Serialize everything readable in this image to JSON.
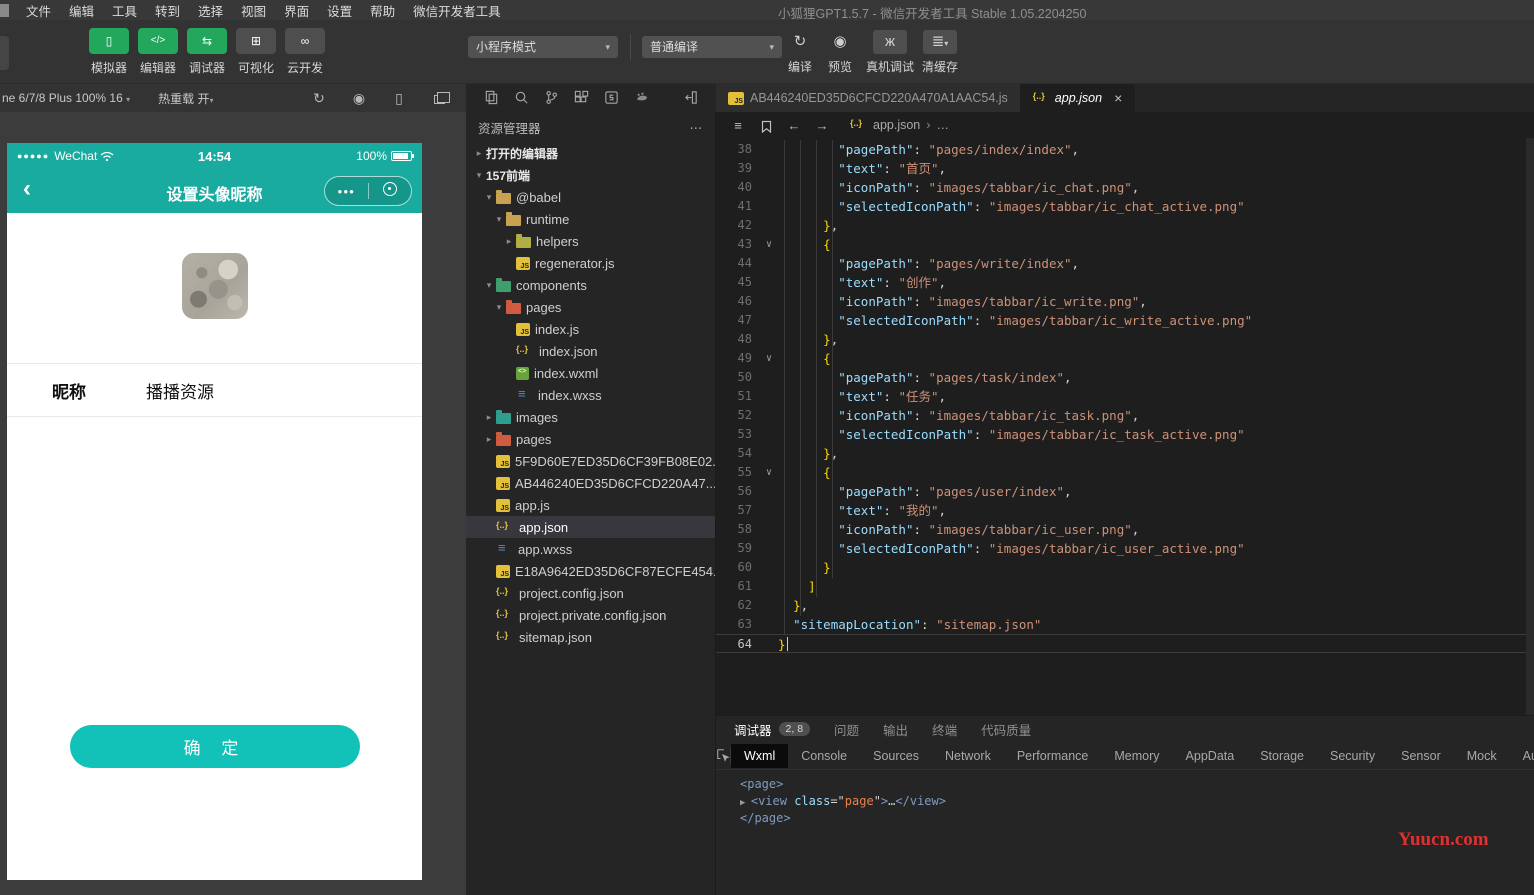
{
  "colors": {
    "wechat_green": "#22a75d",
    "phone_teal": "#19ab9f",
    "confirm_teal": "#12c1b7",
    "editor_key": "#9cdcfe",
    "editor_string": "#ce9178",
    "editor_brace": "#ffd700",
    "watermark_red": "#e03030",
    "selected_row": "#37373d"
  },
  "window": {
    "title": "小狐狸GPT1.5.7 - 微信开发者工具 Stable 1.05.2204250",
    "menu": [
      "文件",
      "编辑",
      "工具",
      "转到",
      "选择",
      "视图",
      "界面",
      "设置",
      "帮助",
      "微信开发者工具"
    ]
  },
  "toolbar": {
    "simulator": "模拟器",
    "editor": "编辑器",
    "debugger": "调试器",
    "visual": "可视化",
    "cloud": "云开发",
    "mode_select": "小程序模式",
    "compile_select": "普通编译",
    "compile": "编译",
    "preview": "预览",
    "real_device": "真机调试",
    "clear_cache": "清缓存"
  },
  "simbar": {
    "device": "ne 6/7/8 Plus 100% 16",
    "hot_reload": "热重载 开"
  },
  "phone": {
    "carrier": "WeChat",
    "signal_dots": "●●●●●",
    "time": "14:54",
    "battery": "100%",
    "back": "‹",
    "nav_title": "设置头像昵称",
    "capsule_more": "●●●",
    "nick_label": "昵称",
    "nick_value": "播播资源",
    "confirm": "确 定"
  },
  "explorer": {
    "title": "资源管理器",
    "more": "⋯",
    "items": [
      {
        "label": "打开的编辑器",
        "depth": 0,
        "arrow": "▸",
        "icon": "none",
        "section": true
      },
      {
        "label": "157前端",
        "depth": 0,
        "arrow": "▾",
        "icon": "none",
        "section": true
      },
      {
        "label": "@babel",
        "depth": 1,
        "arrow": "▾",
        "icon": "folder-yellow"
      },
      {
        "label": "runtime",
        "depth": 2,
        "arrow": "▾",
        "icon": "folder-yellow"
      },
      {
        "label": "helpers",
        "depth": 3,
        "arrow": "▸",
        "icon": "folder-olive"
      },
      {
        "label": "regenerator.js",
        "depth": 3,
        "arrow": "",
        "icon": "js"
      },
      {
        "label": "components",
        "depth": 1,
        "arrow": "▾",
        "icon": "folder-green"
      },
      {
        "label": "pages",
        "depth": 2,
        "arrow": "▾",
        "icon": "folder-red"
      },
      {
        "label": "index.js",
        "depth": 3,
        "arrow": "",
        "icon": "js"
      },
      {
        "label": "index.json",
        "depth": 3,
        "arrow": "",
        "icon": "json"
      },
      {
        "label": "index.wxml",
        "depth": 3,
        "arrow": "",
        "icon": "wxml"
      },
      {
        "label": "index.wxss",
        "depth": 3,
        "arrow": "",
        "icon": "wxss"
      },
      {
        "label": "images",
        "depth": 1,
        "arrow": "▸",
        "icon": "folder-teal"
      },
      {
        "label": "pages",
        "depth": 1,
        "arrow": "▸",
        "icon": "folder-red"
      },
      {
        "label": "5F9D60E7ED35D6CF39FB08E02...",
        "depth": 1,
        "arrow": "",
        "icon": "js"
      },
      {
        "label": "AB446240ED35D6CFCD220A47...",
        "depth": 1,
        "arrow": "",
        "icon": "js"
      },
      {
        "label": "app.js",
        "depth": 1,
        "arrow": "",
        "icon": "js"
      },
      {
        "label": "app.json",
        "depth": 1,
        "arrow": "",
        "icon": "json",
        "selected": true
      },
      {
        "label": "app.wxss",
        "depth": 1,
        "arrow": "",
        "icon": "wxss"
      },
      {
        "label": "E18A9642ED35D6CF87ECFE454...",
        "depth": 1,
        "arrow": "",
        "icon": "js"
      },
      {
        "label": "project.config.json",
        "depth": 1,
        "arrow": "",
        "icon": "json"
      },
      {
        "label": "project.private.config.json",
        "depth": 1,
        "arrow": "",
        "icon": "json"
      },
      {
        "label": "sitemap.json",
        "depth": 1,
        "arrow": "",
        "icon": "json"
      }
    ]
  },
  "editor": {
    "tab1": "AB446240ED35D6CFCD220A470A1AAC54.js",
    "tab2": "app.json",
    "tab2_close": "×",
    "breadcrumb_file": "app.json",
    "breadcrumb_more": "…",
    "code_lines": [
      {
        "n": 38,
        "fold": "",
        "tokens": [
          [
            "ws",
            "        "
          ],
          [
            "key",
            "\"pagePath\""
          ],
          [
            "pun",
            ": "
          ],
          [
            "str",
            "\"pages/index/index\""
          ],
          [
            "pun",
            ","
          ]
        ]
      },
      {
        "n": 39,
        "fold": "",
        "tokens": [
          [
            "ws",
            "        "
          ],
          [
            "key",
            "\"text\""
          ],
          [
            "pun",
            ": "
          ],
          [
            "str",
            "\"首页\""
          ],
          [
            "pun",
            ","
          ]
        ]
      },
      {
        "n": 40,
        "fold": "",
        "tokens": [
          [
            "ws",
            "        "
          ],
          [
            "key",
            "\"iconPath\""
          ],
          [
            "pun",
            ": "
          ],
          [
            "str",
            "\"images/tabbar/ic_chat.png\""
          ],
          [
            "pun",
            ","
          ]
        ]
      },
      {
        "n": 41,
        "fold": "",
        "tokens": [
          [
            "ws",
            "        "
          ],
          [
            "key",
            "\"selectedIconPath\""
          ],
          [
            "pun",
            ": "
          ],
          [
            "str",
            "\"images/tabbar/ic_chat_active.png\""
          ]
        ]
      },
      {
        "n": 42,
        "fold": "",
        "tokens": [
          [
            "ws",
            "      "
          ],
          [
            "br",
            "}"
          ],
          [
            "pun",
            ","
          ]
        ]
      },
      {
        "n": 43,
        "fold": "∨",
        "tokens": [
          [
            "ws",
            "      "
          ],
          [
            "br",
            "{"
          ]
        ]
      },
      {
        "n": 44,
        "fold": "",
        "tokens": [
          [
            "ws",
            "        "
          ],
          [
            "key",
            "\"pagePath\""
          ],
          [
            "pun",
            ": "
          ],
          [
            "str",
            "\"pages/write/index\""
          ],
          [
            "pun",
            ","
          ]
        ]
      },
      {
        "n": 45,
        "fold": "",
        "tokens": [
          [
            "ws",
            "        "
          ],
          [
            "key",
            "\"text\""
          ],
          [
            "pun",
            ": "
          ],
          [
            "str",
            "\"创作\""
          ],
          [
            "pun",
            ","
          ]
        ]
      },
      {
        "n": 46,
        "fold": "",
        "tokens": [
          [
            "ws",
            "        "
          ],
          [
            "key",
            "\"iconPath\""
          ],
          [
            "pun",
            ": "
          ],
          [
            "str",
            "\"images/tabbar/ic_write.png\""
          ],
          [
            "pun",
            ","
          ]
        ]
      },
      {
        "n": 47,
        "fold": "",
        "tokens": [
          [
            "ws",
            "        "
          ],
          [
            "key",
            "\"selectedIconPath\""
          ],
          [
            "pun",
            ": "
          ],
          [
            "str",
            "\"images/tabbar/ic_write_active.png\""
          ]
        ]
      },
      {
        "n": 48,
        "fold": "",
        "tokens": [
          [
            "ws",
            "      "
          ],
          [
            "br",
            "}"
          ],
          [
            "pun",
            ","
          ]
        ]
      },
      {
        "n": 49,
        "fold": "∨",
        "tokens": [
          [
            "ws",
            "      "
          ],
          [
            "br",
            "{"
          ]
        ]
      },
      {
        "n": 50,
        "fold": "",
        "tokens": [
          [
            "ws",
            "        "
          ],
          [
            "key",
            "\"pagePath\""
          ],
          [
            "pun",
            ": "
          ],
          [
            "str",
            "\"pages/task/index\""
          ],
          [
            "pun",
            ","
          ]
        ]
      },
      {
        "n": 51,
        "fold": "",
        "tokens": [
          [
            "ws",
            "        "
          ],
          [
            "key",
            "\"text\""
          ],
          [
            "pun",
            ": "
          ],
          [
            "str",
            "\"任务\""
          ],
          [
            "pun",
            ","
          ]
        ]
      },
      {
        "n": 52,
        "fold": "",
        "tokens": [
          [
            "ws",
            "        "
          ],
          [
            "key",
            "\"iconPath\""
          ],
          [
            "pun",
            ": "
          ],
          [
            "str",
            "\"images/tabbar/ic_task.png\""
          ],
          [
            "pun",
            ","
          ]
        ]
      },
      {
        "n": 53,
        "fold": "",
        "tokens": [
          [
            "ws",
            "        "
          ],
          [
            "key",
            "\"selectedIconPath\""
          ],
          [
            "pun",
            ": "
          ],
          [
            "str",
            "\"images/tabbar/ic_task_active.png\""
          ]
        ]
      },
      {
        "n": 54,
        "fold": "",
        "tokens": [
          [
            "ws",
            "      "
          ],
          [
            "br",
            "}"
          ],
          [
            "pun",
            ","
          ]
        ]
      },
      {
        "n": 55,
        "fold": "∨",
        "tokens": [
          [
            "ws",
            "      "
          ],
          [
            "br",
            "{"
          ]
        ]
      },
      {
        "n": 56,
        "fold": "",
        "tokens": [
          [
            "ws",
            "        "
          ],
          [
            "key",
            "\"pagePath\""
          ],
          [
            "pun",
            ": "
          ],
          [
            "str",
            "\"pages/user/index\""
          ],
          [
            "pun",
            ","
          ]
        ]
      },
      {
        "n": 57,
        "fold": "",
        "tokens": [
          [
            "ws",
            "        "
          ],
          [
            "key",
            "\"text\""
          ],
          [
            "pun",
            ": "
          ],
          [
            "str",
            "\"我的\""
          ],
          [
            "pun",
            ","
          ]
        ]
      },
      {
        "n": 58,
        "fold": "",
        "tokens": [
          [
            "ws",
            "        "
          ],
          [
            "key",
            "\"iconPath\""
          ],
          [
            "pun",
            ": "
          ],
          [
            "str",
            "\"images/tabbar/ic_user.png\""
          ],
          [
            "pun",
            ","
          ]
        ]
      },
      {
        "n": 59,
        "fold": "",
        "tokens": [
          [
            "ws",
            "        "
          ],
          [
            "key",
            "\"selectedIconPath\""
          ],
          [
            "pun",
            ": "
          ],
          [
            "str",
            "\"images/tabbar/ic_user_active.png\""
          ]
        ]
      },
      {
        "n": 60,
        "fold": "",
        "tokens": [
          [
            "ws",
            "      "
          ],
          [
            "br",
            "}"
          ]
        ]
      },
      {
        "n": 61,
        "fold": "",
        "tokens": [
          [
            "ws",
            "    "
          ],
          [
            "br",
            "]"
          ]
        ]
      },
      {
        "n": 62,
        "fold": "",
        "tokens": [
          [
            "ws",
            "  "
          ],
          [
            "br",
            "}"
          ],
          [
            "pun",
            ","
          ]
        ]
      },
      {
        "n": 63,
        "fold": "",
        "tokens": [
          [
            "ws",
            "  "
          ],
          [
            "key",
            "\"sitemapLocation\""
          ],
          [
            "pun",
            ": "
          ],
          [
            "str",
            "\"sitemap.json\""
          ]
        ]
      },
      {
        "n": 64,
        "fold": "",
        "cursor": true,
        "tokens": [
          [
            "br",
            "}"
          ]
        ]
      }
    ]
  },
  "debug": {
    "panel_tabs": [
      {
        "label": "调试器",
        "active": true,
        "badge": "2, 8"
      },
      {
        "label": "问题"
      },
      {
        "label": "输出"
      },
      {
        "label": "终端"
      },
      {
        "label": "代码质量"
      }
    ],
    "devtools_tabs": [
      {
        "label": "Wxml",
        "active": true
      },
      {
        "label": "Console"
      },
      {
        "label": "Sources"
      },
      {
        "label": "Network"
      },
      {
        "label": "Performance"
      },
      {
        "label": "Memory"
      },
      {
        "label": "AppData"
      },
      {
        "label": "Storage"
      },
      {
        "label": "Security"
      },
      {
        "label": "Sensor"
      },
      {
        "label": "Mock"
      },
      {
        "label": "Audit"
      }
    ],
    "console_lines": [
      {
        "tokens": [
          [
            "tag",
            "<page>"
          ]
        ]
      },
      {
        "tokens": [
          [
            "arrow",
            "▶ "
          ],
          [
            "tag",
            "<view "
          ],
          [
            "attr",
            "class"
          ],
          [
            "pun",
            "=\""
          ],
          [
            "val",
            "page"
          ],
          [
            "pun",
            "\""
          ],
          [
            "tag",
            ">"
          ],
          [
            "dots",
            "…"
          ],
          [
            "tag",
            "</view>"
          ]
        ]
      },
      {
        "tokens": [
          [
            "tag",
            "</page>"
          ]
        ]
      }
    ]
  },
  "watermark": "Yuucn.com"
}
